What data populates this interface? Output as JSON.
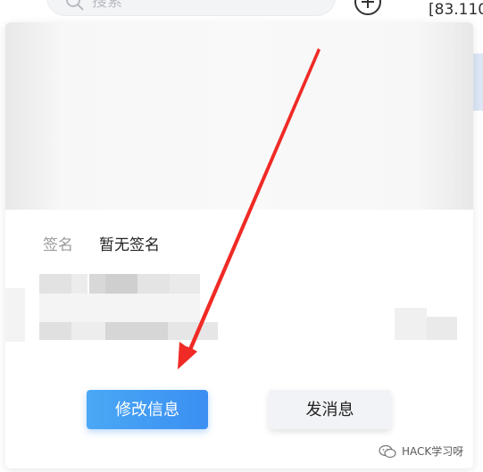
{
  "background_app": {
    "search_placeholder": "搜索",
    "ip_text": "[83.110"
  },
  "profile_card": {
    "signature_label": "签名",
    "signature_value": "暂无签名",
    "edit_button_label": "修改信息",
    "message_button_label": "发消息"
  },
  "annotation": {
    "arrow_color": "#f02a25",
    "watermark_text": "HACK学习呀"
  },
  "colors": {
    "primary": "#3b8ff2",
    "secondary_button_bg": "#f2f3f6"
  },
  "icons": [
    "search-icon",
    "add-circle-icon",
    "wechat-icon",
    "arrow-annotation"
  ]
}
